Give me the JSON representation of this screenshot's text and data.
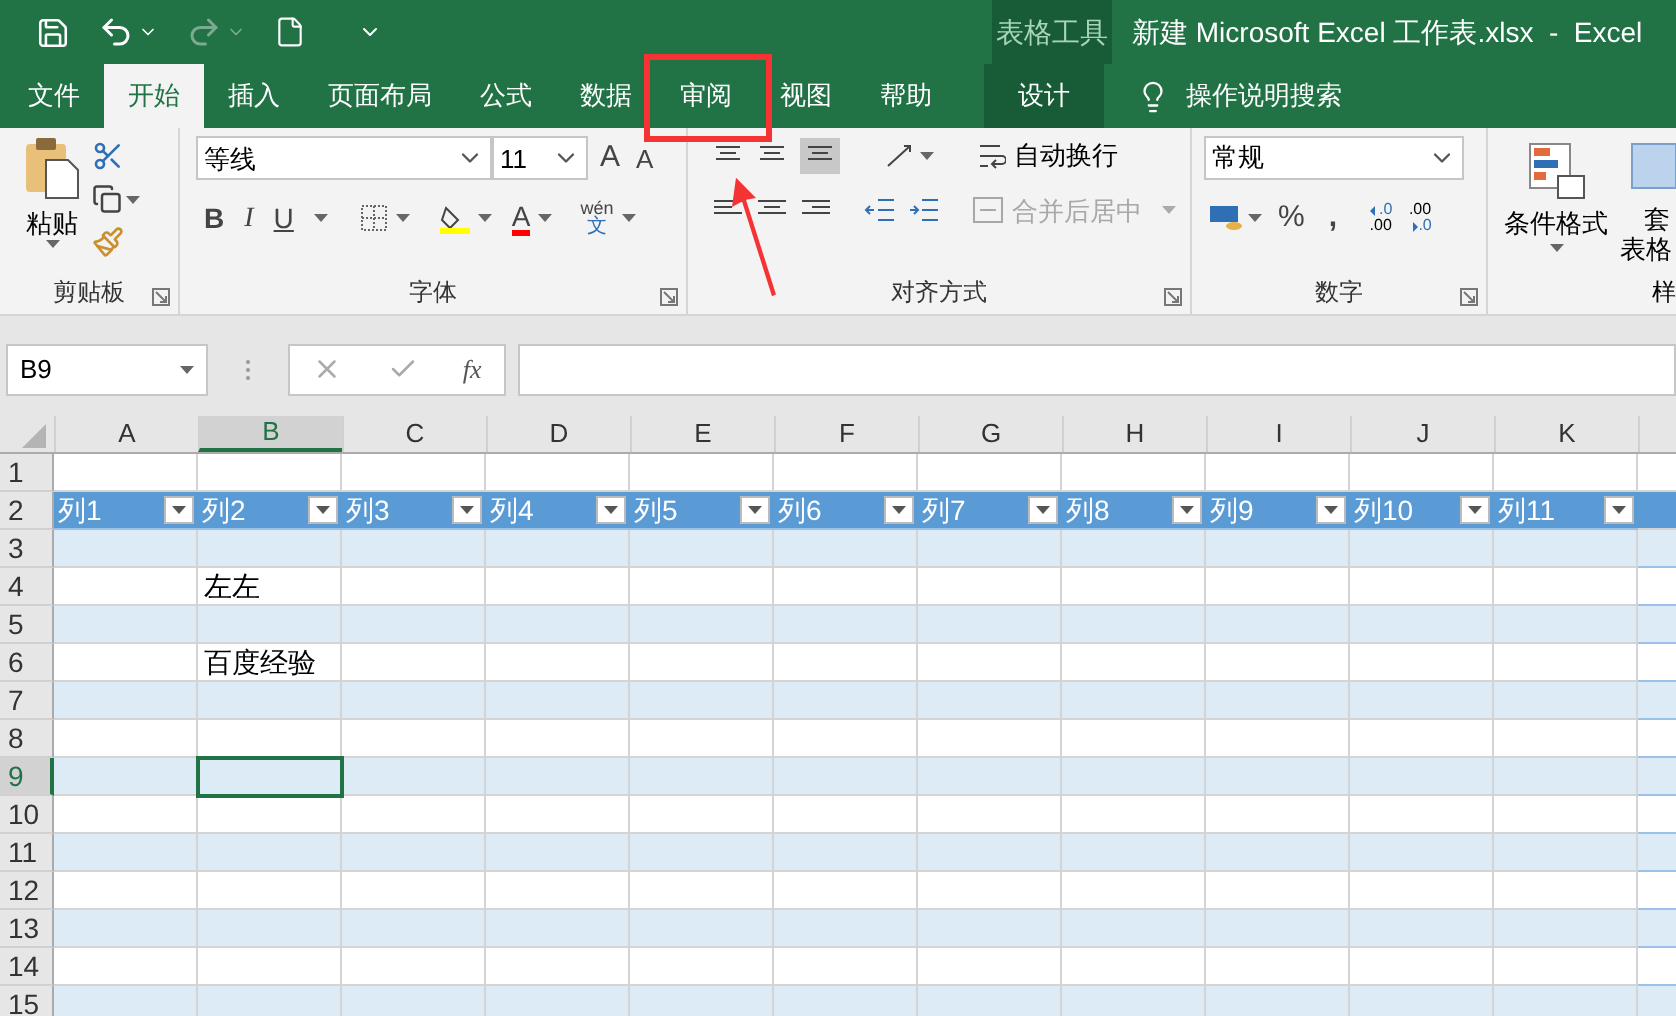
{
  "title_bar": {
    "context_label": "表格工具",
    "title": "新建 Microsoft Excel 工作表.xlsx  -  Excel"
  },
  "tabs": [
    {
      "label": "文件",
      "selected": false,
      "kind": "normal"
    },
    {
      "label": "开始",
      "selected": true,
      "kind": "normal"
    },
    {
      "label": "插入",
      "selected": false,
      "kind": "normal"
    },
    {
      "label": "页面布局",
      "selected": false,
      "kind": "normal"
    },
    {
      "label": "公式",
      "selected": false,
      "kind": "normal"
    },
    {
      "label": "数据",
      "selected": false,
      "kind": "normal"
    },
    {
      "label": "审阅",
      "selected": false,
      "kind": "normal"
    },
    {
      "label": "视图",
      "selected": false,
      "kind": "normal"
    },
    {
      "label": "帮助",
      "selected": false,
      "kind": "normal"
    },
    {
      "label": "设计",
      "selected": false,
      "kind": "contextual"
    }
  ],
  "tell_me": {
    "placeholder": "操作说明搜索"
  },
  "ribbon": {
    "clipboard": {
      "paste": "粘贴",
      "label": "剪贴板"
    },
    "font": {
      "font_name": "等线",
      "font_size": "11",
      "grow": "A",
      "shrink": "A",
      "bold": "B",
      "italic": "I",
      "underline": "U",
      "font_color": "A",
      "phonetic_top": "wén",
      "phonetic_bottom": "文",
      "label": "字体"
    },
    "alignment": {
      "wrap_text": "自动换行",
      "merge_center": {
        "label": "合并后居中",
        "disabled": true
      },
      "label": "对齐方式"
    },
    "number": {
      "format": "常规",
      "percent": "%",
      "comma": ",",
      "increase_decimal": {
        "top": ".0",
        "bottom": ".00"
      },
      "decrease_decimal": {
        "top": ".00",
        "bottom": ".0"
      },
      "label": "数字"
    },
    "styles": {
      "conditional_format": "条件格式",
      "format_as_table_top": "套",
      "format_as_table_bottom": "表格",
      "label": "样"
    }
  },
  "formula_bar": {
    "name_box": "B9",
    "fx": "fx"
  },
  "columns": [
    {
      "label": "A",
      "selected": false
    },
    {
      "label": "B",
      "selected": true
    },
    {
      "label": "C",
      "selected": false
    },
    {
      "label": "D",
      "selected": false
    },
    {
      "label": "E",
      "selected": false
    },
    {
      "label": "F",
      "selected": false
    },
    {
      "label": "G",
      "selected": false
    },
    {
      "label": "H",
      "selected": false
    },
    {
      "label": "I",
      "selected": false
    },
    {
      "label": "J",
      "selected": false
    },
    {
      "label": "K",
      "selected": false
    }
  ],
  "table_headers": [
    "列1",
    "列2",
    "列3",
    "列4",
    "列5",
    "列6",
    "列7",
    "列8",
    "列9",
    "列10",
    "列11"
  ],
  "rows": [
    {
      "number": "1",
      "selected": false,
      "kind": "empty"
    },
    {
      "number": "2",
      "selected": false,
      "kind": "header"
    },
    {
      "number": "3",
      "selected": false,
      "kind": "data",
      "banded": true
    },
    {
      "number": "4",
      "selected": false,
      "kind": "data",
      "banded": false,
      "column_b": "左左"
    },
    {
      "number": "5",
      "selected": false,
      "kind": "data",
      "banded": true
    },
    {
      "number": "6",
      "selected": false,
      "kind": "data",
      "banded": false,
      "column_b": "百度经验"
    },
    {
      "number": "7",
      "selected": false,
      "kind": "data",
      "banded": true
    },
    {
      "number": "8",
      "selected": false,
      "kind": "data",
      "banded": false
    },
    {
      "number": "9",
      "selected": true,
      "kind": "data",
      "banded": true
    },
    {
      "number": "10",
      "selected": false,
      "kind": "data",
      "banded": false
    },
    {
      "number": "11",
      "selected": false,
      "kind": "data",
      "banded": true
    },
    {
      "number": "12",
      "selected": false,
      "kind": "data",
      "banded": false
    },
    {
      "number": "13",
      "selected": false,
      "kind": "data",
      "banded": true
    },
    {
      "number": "14",
      "selected": false,
      "kind": "data",
      "banded": false
    },
    {
      "number": "15",
      "selected": false,
      "kind": "data",
      "banded": true
    }
  ]
}
